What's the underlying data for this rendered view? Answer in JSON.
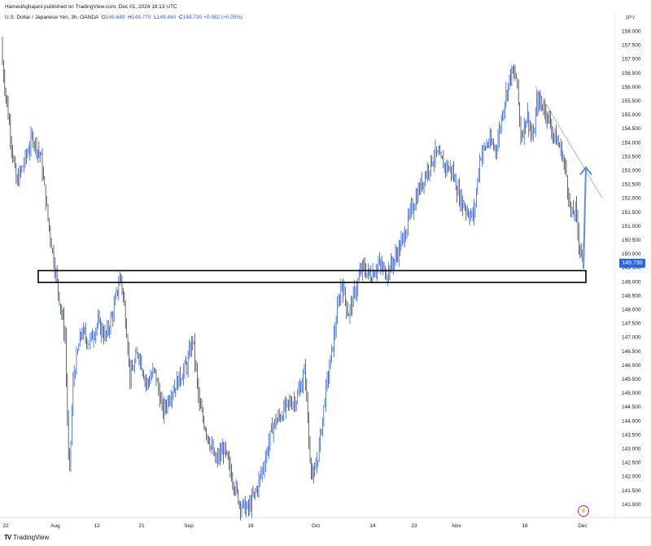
{
  "header": {
    "publisher_line": "HamedAghajani published on TradingView.com, Dec 01, 2024 18:13 UTC",
    "symbol": "U.S. Dollar / Japanese Yen, 3h, OANDA",
    "ohlc": [
      {
        "key": "O",
        "value": "149.649"
      },
      {
        "key": "H",
        "value": "149.770"
      },
      {
        "key": "L",
        "value": "149.480"
      },
      {
        "key": "C",
        "value": "149.730"
      }
    ],
    "change": "+0.082 (+0.05%)"
  },
  "footer": {
    "logo_text": "TradingView"
  },
  "colors": {
    "candle": "#2962ff",
    "candle_alt": "#3b4257",
    "trendline": "#b2b5be",
    "price_tag": "#2962ff",
    "zone_border": "#000000",
    "grid": "#f0f3fa"
  },
  "icons": [
    "tradingview-logo-icon",
    "lightning-bolt-icon",
    "up-arrow-icon"
  ],
  "chart_data": {
    "type": "line",
    "currency": "JPY",
    "last_price": "149.730",
    "y_ticks": [
      "158.000",
      "157.500",
      "157.000",
      "156.500",
      "156.000",
      "155.500",
      "155.000",
      "154.500",
      "154.000",
      "153.500",
      "153.000",
      "152.500",
      "152.000",
      "151.500",
      "151.000",
      "150.500",
      "150.000",
      "149.500",
      "149.000",
      "148.500",
      "148.000",
      "147.500",
      "147.000",
      "146.500",
      "146.000",
      "145.500",
      "145.000",
      "144.500",
      "144.000",
      "143.500",
      "143.000",
      "142.500",
      "142.000",
      "141.500",
      "141.000"
    ],
    "x_ticks": [
      "22",
      "Aug",
      "12",
      "21",
      "Sep",
      "16",
      "Oct",
      "14",
      "23",
      "Nov",
      "18",
      "Dec"
    ],
    "ylim": [
      140.6,
      158.5
    ],
    "grid": false,
    "price_path": [
      [
        0,
        157.6
      ],
      [
        8,
        155.5
      ],
      [
        20,
        152.5
      ],
      [
        30,
        153.3
      ],
      [
        40,
        154.2
      ],
      [
        50,
        153.5
      ],
      [
        60,
        151.0
      ],
      [
        70,
        149.0
      ],
      [
        80,
        147.0
      ],
      [
        85,
        141.8
      ],
      [
        90,
        145.5
      ],
      [
        100,
        147.2
      ],
      [
        110,
        146.8
      ],
      [
        120,
        147.5
      ],
      [
        130,
        147.0
      ],
      [
        140,
        148.0
      ],
      [
        148,
        149.3
      ],
      [
        155,
        147.5
      ],
      [
        160,
        145.5
      ],
      [
        170,
        146.5
      ],
      [
        180,
        145.3
      ],
      [
        190,
        145.8
      ],
      [
        200,
        144.3
      ],
      [
        210,
        145.0
      ],
      [
        220,
        145.5
      ],
      [
        230,
        146.0
      ],
      [
        237,
        147.0
      ],
      [
        245,
        144.5
      ],
      [
        255,
        143.5
      ],
      [
        265,
        142.5
      ],
      [
        275,
        143.0
      ],
      [
        285,
        142.0
      ],
      [
        295,
        141.0
      ],
      [
        305,
        140.8
      ],
      [
        315,
        141.5
      ],
      [
        325,
        142.5
      ],
      [
        335,
        143.8
      ],
      [
        345,
        144.2
      ],
      [
        355,
        144.6
      ],
      [
        365,
        144.8
      ],
      [
        375,
        145.8
      ],
      [
        380,
        143.0
      ],
      [
        385,
        141.8
      ],
      [
        392,
        143.0
      ],
      [
        400,
        145.0
      ],
      [
        408,
        146.5
      ],
      [
        415,
        148.0
      ],
      [
        420,
        149.0
      ],
      [
        428,
        147.8
      ],
      [
        435,
        148.5
      ],
      [
        445,
        149.5
      ],
      [
        455,
        149.2
      ],
      [
        465,
        149.6
      ],
      [
        475,
        149.3
      ],
      [
        485,
        149.8
      ],
      [
        495,
        150.5
      ],
      [
        505,
        151.5
      ],
      [
        515,
        152.3
      ],
      [
        525,
        153.0
      ],
      [
        535,
        153.6
      ],
      [
        545,
        153.2
      ],
      [
        555,
        153.0
      ],
      [
        565,
        152.0
      ],
      [
        575,
        151.5
      ],
      [
        582,
        151.3
      ],
      [
        590,
        153.5
      ],
      [
        600,
        154.0
      ],
      [
        610,
        153.8
      ],
      [
        620,
        155.5
      ],
      [
        628,
        156.5
      ],
      [
        635,
        156.3
      ],
      [
        640,
        154.2
      ],
      [
        648,
        155.0
      ],
      [
        655,
        154.0
      ],
      [
        660,
        155.5
      ],
      [
        670,
        155.2
      ],
      [
        680,
        154.3
      ],
      [
        690,
        153.7
      ],
      [
        696,
        152.8
      ],
      [
        702,
        151.3
      ],
      [
        707,
        151.6
      ],
      [
        712,
        150.3
      ],
      [
        718,
        149.73
      ]
    ],
    "support_zone": [
      149.05,
      149.3
    ],
    "trendline": [
      [
        658,
        156.0
      ],
      [
        740,
        152.0
      ]
    ],
    "arrow_target": 153.1
  }
}
